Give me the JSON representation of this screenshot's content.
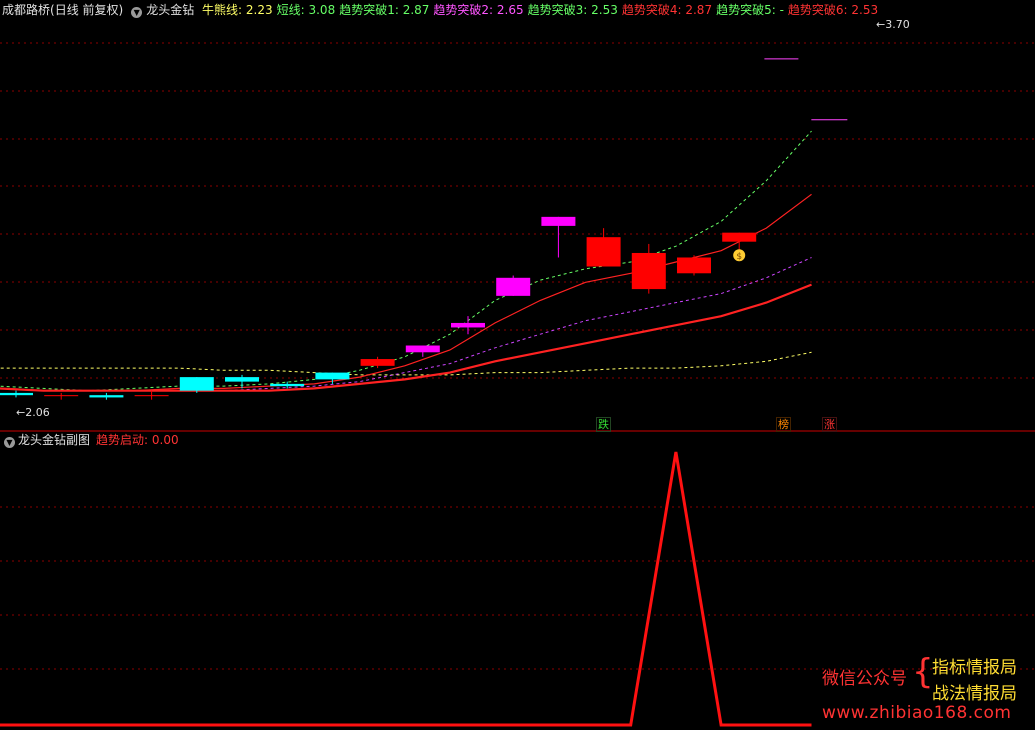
{
  "header": {
    "stock_name": "成都路桥",
    "period": "(日线 前复权)",
    "indicator_name": "龙头金钻",
    "items": [
      {
        "label": "牛熊线: ",
        "value": "2.23",
        "color": "#ffff66"
      },
      {
        "label": "短线: ",
        "value": "3.08",
        "color": "#66ff66"
      },
      {
        "label": "趋势突破1: ",
        "value": "2.87",
        "color": "#66ff66"
      },
      {
        "label": "趋势突破2: ",
        "value": "2.65",
        "color": "#ff55ff"
      },
      {
        "label": "趋势突破3: ",
        "value": "2.53",
        "color": "#66ff66"
      },
      {
        "label": "趋势突破4: ",
        "value": "2.87",
        "color": "#ff3333"
      },
      {
        "label": "趋势突破5: ",
        "value": "-",
        "color": "#66ff66"
      },
      {
        "label": "趋势突破6: ",
        "value": "2.53",
        "color": "#ff3333"
      }
    ]
  },
  "price_labels": {
    "high": "3.70",
    "low": "2.06"
  },
  "signals": [
    {
      "text": "跌",
      "color": "#33dd33"
    },
    {
      "text": "榜",
      "color": "#ff8800"
    },
    {
      "text": "涨",
      "color": "#ff3333"
    }
  ],
  "sub_panel": {
    "title": "龙头金钻副图",
    "item_label": "趋势启动: ",
    "item_value": "0.00"
  },
  "watermark": {
    "left": "微信公众号",
    "brace": "{",
    "line1": "指标情报局",
    "line2": "战法情报局",
    "url": "www.zhibiao168.com"
  },
  "colors": {
    "background": "#000000",
    "up_candle": "#ff0000",
    "down_candle": "#00ffff",
    "limit_up_candle": "#ff00ff",
    "grid": "#8b0000"
  },
  "chart_data": {
    "type": "candlestick",
    "y_range": [
      2.0,
      3.75
    ],
    "candles": [
      {
        "o": 2.12,
        "h": 2.13,
        "l": 2.1,
        "c": 2.11
      },
      {
        "o": 2.11,
        "h": 2.12,
        "l": 2.09,
        "c": 2.11
      },
      {
        "o": 2.11,
        "h": 2.12,
        "l": 2.09,
        "c": 2.1
      },
      {
        "o": 2.11,
        "h": 2.13,
        "l": 2.09,
        "c": 2.11
      },
      {
        "o": 2.19,
        "h": 2.19,
        "l": 2.12,
        "c": 2.13
      },
      {
        "o": 2.19,
        "h": 2.2,
        "l": 2.14,
        "c": 2.17
      },
      {
        "o": 2.16,
        "h": 2.17,
        "l": 2.14,
        "c": 2.15
      },
      {
        "o": 2.21,
        "h": 2.21,
        "l": 2.16,
        "c": 2.18
      },
      {
        "o": 2.24,
        "h": 2.28,
        "l": 2.23,
        "c": 2.27
      },
      {
        "o": 2.3,
        "h": 2.33,
        "l": 2.28,
        "c": 2.33
      },
      {
        "o": 2.41,
        "h": 2.46,
        "l": 2.38,
        "c": 2.43
      },
      {
        "o": 2.55,
        "h": 2.64,
        "l": 2.55,
        "c": 2.63
      },
      {
        "o": 2.9,
        "h": 2.9,
        "l": 2.72,
        "c": 2.86
      },
      {
        "o": 2.68,
        "h": 2.85,
        "l": 2.68,
        "c": 2.81
      },
      {
        "o": 2.58,
        "h": 2.78,
        "l": 2.56,
        "c": 2.74
      },
      {
        "o": 2.65,
        "h": 2.73,
        "l": 2.64,
        "c": 2.72
      },
      {
        "o": 2.79,
        "h": 2.83,
        "l": 2.72,
        "c": 2.83
      }
    ],
    "series": [
      {
        "name": "牛熊线",
        "color": "#ffff66",
        "dash": true,
        "values": [
          2.23,
          2.23,
          2.23,
          2.23,
          2.23,
          2.23,
          2.22,
          2.22,
          2.21,
          2.2,
          2.2,
          2.2,
          2.21,
          2.21,
          2.22,
          2.23,
          2.23,
          2.24,
          2.26,
          2.3
        ]
      },
      {
        "name": "短线",
        "color": "#66ff66",
        "dash": true,
        "values": [
          2.16,
          2.15,
          2.14,
          2.13,
          2.14,
          2.15,
          2.15,
          2.16,
          2.18,
          2.22,
          2.28,
          2.38,
          2.53,
          2.62,
          2.67,
          2.7,
          2.77,
          2.88,
          3.06,
          3.28
        ]
      },
      {
        "name": "趋势突破4",
        "color": "#ff2222",
        "dash": false,
        "width": 1.2,
        "values": [
          2.14,
          2.14,
          2.13,
          2.13,
          2.13,
          2.14,
          2.14,
          2.15,
          2.16,
          2.19,
          2.24,
          2.31,
          2.43,
          2.53,
          2.61,
          2.65,
          2.7,
          2.75,
          2.85,
          3.0
        ]
      },
      {
        "name": "趋势突破2",
        "color": "#cc44ff",
        "dash": true,
        "values": [
          2.14,
          2.14,
          2.13,
          2.13,
          2.13,
          2.13,
          2.13,
          2.14,
          2.15,
          2.17,
          2.21,
          2.25,
          2.32,
          2.38,
          2.44,
          2.48,
          2.52,
          2.56,
          2.63,
          2.72
        ]
      },
      {
        "name": "趋势突破6",
        "color": "#ff2222",
        "dash": false,
        "width": 2.2,
        "values": [
          2.14,
          2.14,
          2.13,
          2.13,
          2.13,
          2.13,
          2.13,
          2.13,
          2.14,
          2.16,
          2.18,
          2.21,
          2.26,
          2.3,
          2.34,
          2.38,
          2.42,
          2.46,
          2.52,
          2.6
        ]
      }
    ],
    "magenta_marks": [
      3.6,
      3.33
    ],
    "sub_series": {
      "name": "趋势启动",
      "values": [
        0,
        0,
        0,
        0,
        0,
        0,
        0,
        0,
        0,
        0,
        0,
        0,
        0,
        0,
        0,
        0,
        1,
        0,
        0,
        0
      ],
      "ylim": [
        0,
        1
      ]
    }
  }
}
